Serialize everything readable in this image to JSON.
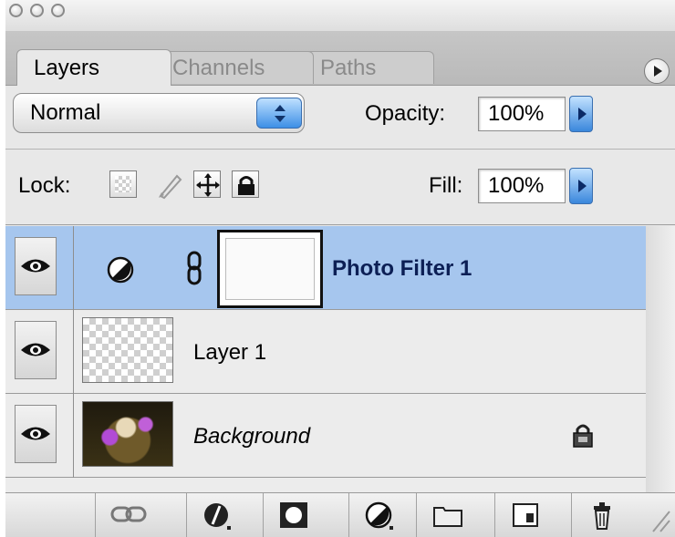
{
  "tabs": {
    "layers": "Layers",
    "channels": "Channels",
    "paths": "Paths"
  },
  "blend": {
    "mode": "Normal",
    "opacity_label": "Opacity:",
    "opacity_value": "100%"
  },
  "lock": {
    "label": "Lock:",
    "fill_label": "Fill:",
    "fill_value": "100%"
  },
  "layers": [
    {
      "name": "Photo Filter 1",
      "type": "adjustment",
      "selected": true,
      "visible": true
    },
    {
      "name": "Layer 1",
      "type": "transparent",
      "selected": false,
      "visible": true
    },
    {
      "name": "Background",
      "type": "image",
      "selected": false,
      "visible": true,
      "locked": true
    }
  ],
  "colors": {
    "selection": "#a6c6ee",
    "panel": "#e8e8e8",
    "accent_blue": "#3a87dc"
  },
  "icons": [
    "window-close-icon",
    "window-minimize-icon",
    "window-zoom-icon",
    "panel-menu-icon",
    "eye-icon",
    "adjustment-icon",
    "link-icon",
    "lock-icon",
    "move-icon",
    "brush-icon",
    "link-layers-icon",
    "layer-style-icon",
    "layer-mask-icon",
    "new-adjustment-icon",
    "new-group-icon",
    "new-layer-icon",
    "delete-icon"
  ]
}
